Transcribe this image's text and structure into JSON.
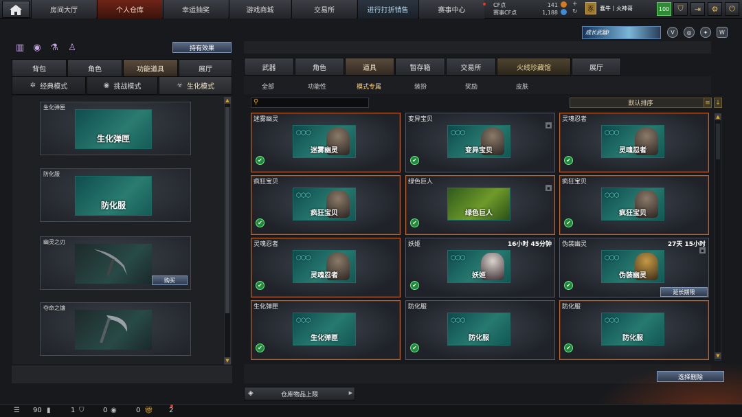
{
  "topnav": {
    "home_icon": "home-icon",
    "tabs": [
      "房间大厅",
      "个人仓库",
      "幸运抽奖",
      "游戏商城",
      "交易所",
      "进行打折销售",
      "赛事中心"
    ]
  },
  "account": {
    "cf_label": "CF点",
    "cf_value": "141",
    "match_cf_label": "赛事CF点",
    "match_cf_value": "1,188",
    "rank_glyph": "豕",
    "player_name": "蠢牛丨火神哥",
    "level": "100"
  },
  "banner": {
    "text": "成长武器!"
  },
  "left": {
    "effects_button": "持有效果",
    "tabs": [
      "背包",
      "角色",
      "功能道具",
      "展厅"
    ],
    "modes": [
      "经典模式",
      "挑战模式",
      "生化模式"
    ],
    "items": [
      {
        "name": "生化弹匣",
        "art": "生化弹匣"
      },
      {
        "name": "防化服",
        "art": "防化服"
      },
      {
        "name": "幽灵之刃",
        "art": ""
      },
      {
        "name": "夺命之镰",
        "art": ""
      }
    ],
    "buy_button": "购买"
  },
  "right": {
    "tabs": [
      "武器",
      "角色",
      "道具",
      "暂存箱",
      "交易所",
      "火线珍藏馆",
      "展厅"
    ],
    "subtabs": [
      "全部",
      "功能性",
      "模式专属",
      "装扮",
      "奖励",
      "皮肤"
    ],
    "sort_label": "默认排序",
    "cards": [
      {
        "name": "迷雾幽灵",
        "art": "迷雾幽灵",
        "time": ""
      },
      {
        "name": "变异宝贝",
        "art": "变异宝贝",
        "time": ""
      },
      {
        "name": "灵魂忍者",
        "art": "灵魂忍者",
        "time": ""
      },
      {
        "name": "疯狂宝贝",
        "art": "疯狂宝贝",
        "time": ""
      },
      {
        "name": "绿色巨人",
        "art": "绿色巨人",
        "time": ""
      },
      {
        "name": "疯狂宝贝",
        "art": "疯狂宝贝",
        "time": ""
      },
      {
        "name": "灵魂忍者",
        "art": "灵魂忍者",
        "time": ""
      },
      {
        "name": "妖姬",
        "art": "妖姬",
        "time": "16小时 45分钟"
      },
      {
        "name": "伪装幽灵",
        "art": "伪装幽灵",
        "time": "27天 15小时"
      },
      {
        "name": "生化弹匣",
        "art": "生化弹匣",
        "time": ""
      },
      {
        "name": "防化服",
        "art": "防化服",
        "time": ""
      },
      {
        "name": "防化服",
        "art": "防化服",
        "time": ""
      }
    ],
    "extend_button": "延长期限",
    "batch_delete_button": "选择删除",
    "storage_limit": "仓库物品上限"
  },
  "bottom": {
    "v1": "90",
    "v2": "1",
    "v3": "0",
    "v4": "0",
    "v5": "2"
  },
  "colors": {
    "accent_orange": "#c0622c",
    "green_ok": "#1f8a3a",
    "active_tab": "#702418"
  }
}
